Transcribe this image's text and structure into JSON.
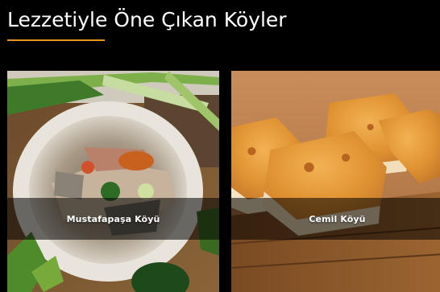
{
  "section": {
    "title": "Lezzetiyle Öne Çıkan Köyler",
    "accent_color": "#e8941f"
  },
  "cards": [
    {
      "label": "Mustafapaşa Köyü",
      "image": "soup-bowl-dish-photo"
    },
    {
      "label": "Cemil Köyü",
      "image": "baked-pastry-photo"
    }
  ]
}
